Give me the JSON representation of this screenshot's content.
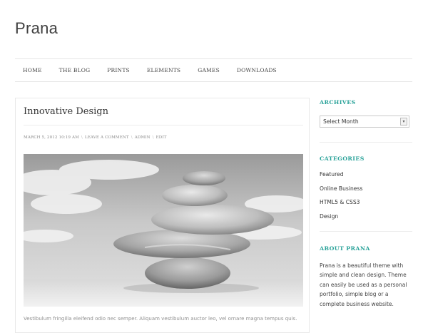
{
  "site": {
    "title": "Prana"
  },
  "nav": {
    "items": [
      {
        "label": "HOME"
      },
      {
        "label": "THE BLOG"
      },
      {
        "label": "PRINTS"
      },
      {
        "label": "ELEMENTS"
      },
      {
        "label": "GAMES"
      },
      {
        "label": "DOWNLOADS"
      }
    ]
  },
  "post": {
    "title": "Innovative Design",
    "meta": {
      "date": "MARCH 5, 2012 10:19 AM",
      "comment": "LEAVE A COMMENT",
      "author": "ADMIN",
      "edit": "EDIT",
      "separator": "\\"
    },
    "image_icon": "stacked-stones-image",
    "excerpt": "Vestibulum fringilla eleifend odio nec semper. Aliquam vestibulum auctor leo, vel ornare magna tempus quis."
  },
  "sidebar": {
    "archives": {
      "title": "ARCHIVES",
      "select_value": "Select Month",
      "arrow_icon": "chevron-down-icon"
    },
    "categories": {
      "title": "CATEGORIES",
      "items": [
        {
          "label": "Featured"
        },
        {
          "label": "Online Business"
        },
        {
          "label": "HTML5 & CSS3"
        },
        {
          "label": "Design"
        }
      ]
    },
    "about": {
      "title": "ABOUT PRANA",
      "text": "Prana is a beautiful theme with simple and clean design. Theme can easily be used as a personal portfolio, simple blog or a complete business website."
    }
  },
  "colors": {
    "accent": "#2ba39a",
    "text": "#333333",
    "border": "#e8e8e8"
  }
}
